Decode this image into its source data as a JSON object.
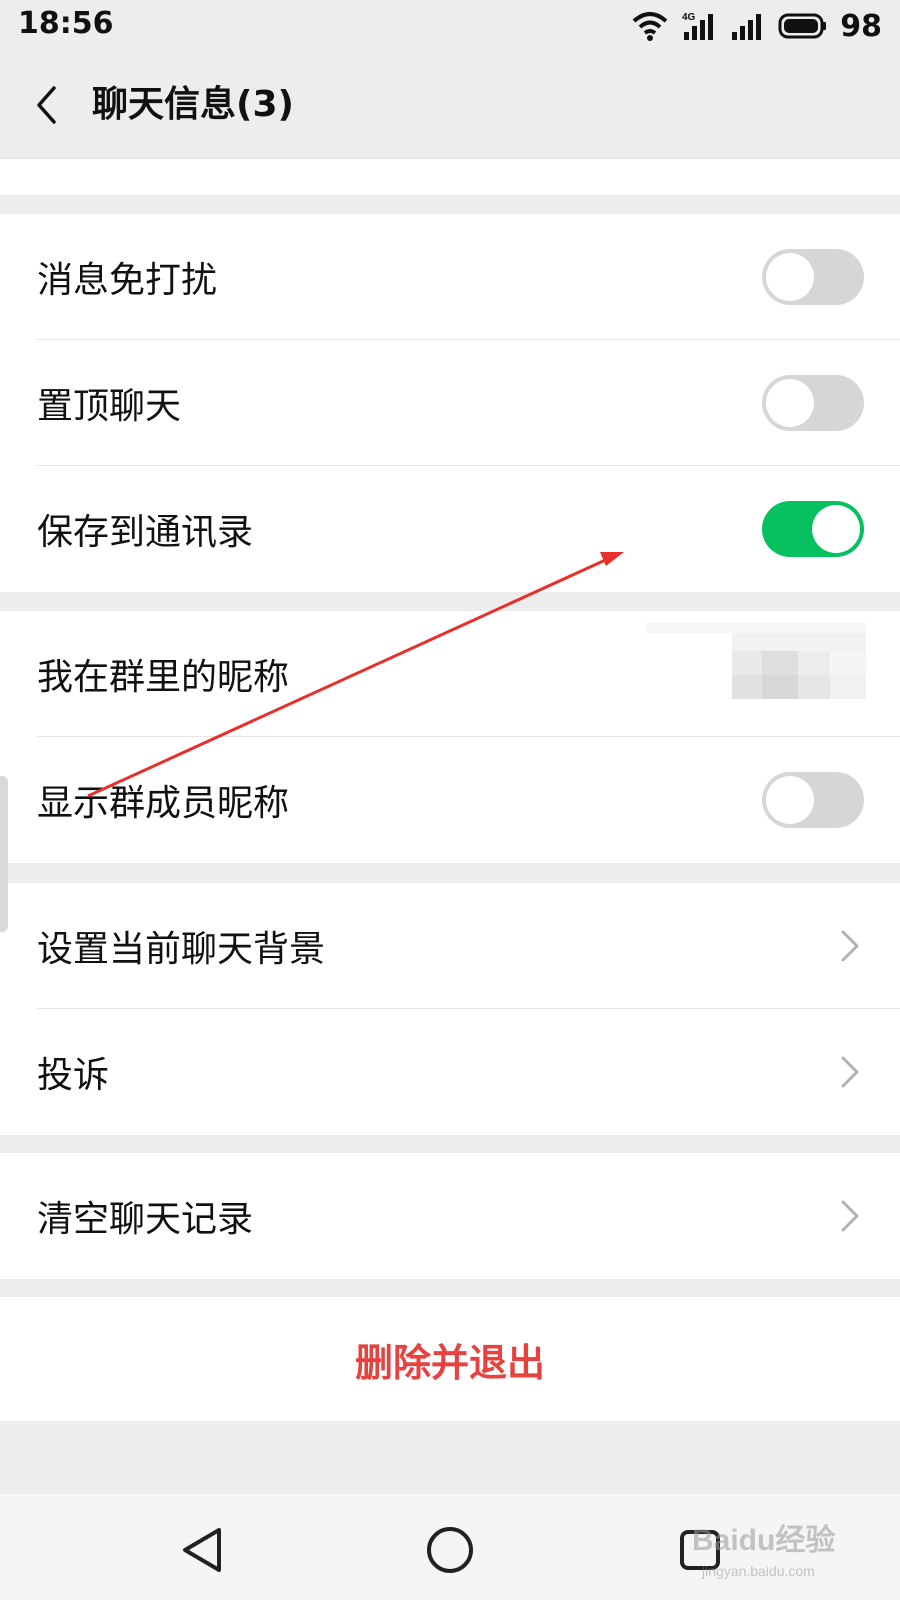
{
  "status_bar": {
    "time": "18:56",
    "battery": "98",
    "network": "4G"
  },
  "header": {
    "title": "聊天信息(3)"
  },
  "groups": {
    "switches": [
      {
        "label": "消息免打扰",
        "on": false
      },
      {
        "label": "置顶聊天",
        "on": false
      },
      {
        "label": "保存到通讯录",
        "on": true
      }
    ],
    "nickname_label": "我在群里的昵称",
    "show_nicknames": {
      "label": "显示群成员昵称",
      "on": false
    },
    "links": [
      {
        "label": "设置当前聊天背景"
      },
      {
        "label": "投诉"
      }
    ],
    "clear": {
      "label": "清空聊天记录"
    }
  },
  "delete_exit": {
    "label": "删除并退出"
  },
  "watermark": {
    "text": "Baidu经验",
    "url": "jingyan.baidu.com"
  },
  "colors": {
    "toggle_on": "#07c160",
    "toggle_off": "#d6d6d6",
    "danger": "#e64340",
    "annotation_arrow": "#e8302a"
  }
}
